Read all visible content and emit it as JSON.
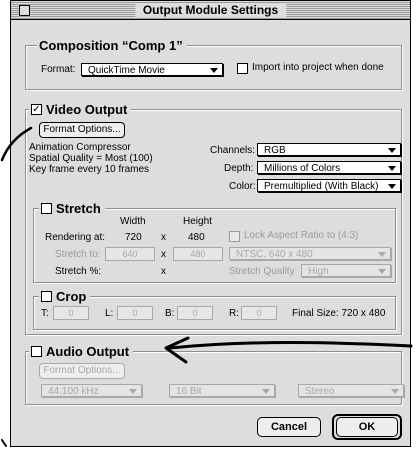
{
  "window": {
    "title": "Output Module Settings"
  },
  "composition": {
    "heading": "Composition “Comp 1”",
    "format_label": "Format:",
    "format_value": "QuickTime Movie",
    "import_label": "Import into project when done"
  },
  "video": {
    "heading": "Video Output",
    "format_options_button": "Format Options...",
    "info_lines": [
      "Animation Compressor",
      "Spatial Quality = Most (100)",
      "Key frame every 10 frames"
    ],
    "channels_label": "Channels:",
    "channels_value": "RGB",
    "depth_label": "Depth:",
    "depth_value": "Millions of Colors",
    "color_label": "Color:",
    "color_value": "Premultiplied (With Black)"
  },
  "stretch": {
    "heading": "Stretch",
    "width_header": "Width",
    "height_header": "Height",
    "rendering_label": "Rendering at:",
    "rendering_width": "720",
    "rendering_x": "x",
    "rendering_height": "480",
    "lock_label": "Lock Aspect Ratio to (4:3)",
    "stretch_to_label": "Stretch to:",
    "stretch_width": "640",
    "stretch_x": "x",
    "stretch_height": "480",
    "preset_value": "NTSC, 640 x 480",
    "percent_label": "Stretch %:",
    "percent_x": "x",
    "quality_label": "Stretch Quality",
    "quality_value": "High"
  },
  "crop": {
    "heading": "Crop",
    "t_label": "T:",
    "t_value": "0",
    "l_label": "L:",
    "l_value": "0",
    "b_label": "B:",
    "b_value": "0",
    "r_label": "R:",
    "r_value": "0",
    "final_size": "Final Size: 720 x 480"
  },
  "audio": {
    "heading": "Audio Output",
    "format_options_button": "Format Options...",
    "rate_value": "44.100 kHz",
    "bits_value": "16 Bit",
    "channels_value": "Stereo"
  },
  "buttons": {
    "cancel": "Cancel",
    "ok": "OK"
  }
}
